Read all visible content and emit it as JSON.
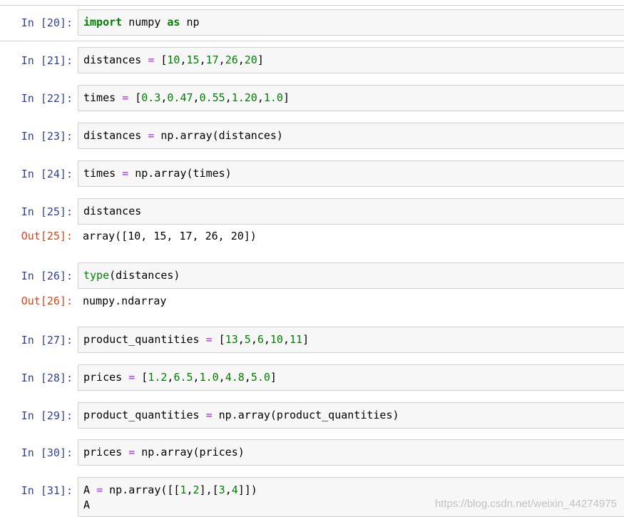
{
  "colors": {
    "prompt_in": "#303f9f",
    "prompt_out": "#d84315",
    "keyword": "#008000",
    "operator": "#aa22ff",
    "number": "#008000",
    "input_bg": "#f7f7f7",
    "input_border": "#cfcfcf"
  },
  "cells": [
    {
      "prompt": "In [20]:",
      "tokens": [
        {
          "t": "import",
          "c": "kw"
        },
        {
          "t": " numpy ",
          "c": ""
        },
        {
          "t": "as",
          "c": "kw"
        },
        {
          "t": " np",
          "c": ""
        }
      ]
    },
    {
      "prompt": "In [21]:",
      "tokens": [
        {
          "t": "distances ",
          "c": ""
        },
        {
          "t": "=",
          "c": "op"
        },
        {
          "t": " [",
          "c": ""
        },
        {
          "t": "10",
          "c": "num"
        },
        {
          "t": ",",
          "c": ""
        },
        {
          "t": "15",
          "c": "num"
        },
        {
          "t": ",",
          "c": ""
        },
        {
          "t": "17",
          "c": "num"
        },
        {
          "t": ",",
          "c": ""
        },
        {
          "t": "26",
          "c": "num"
        },
        {
          "t": ",",
          "c": ""
        },
        {
          "t": "20",
          "c": "num"
        },
        {
          "t": "]",
          "c": ""
        }
      ]
    },
    {
      "prompt": "In [22]:",
      "tokens": [
        {
          "t": "times ",
          "c": ""
        },
        {
          "t": "=",
          "c": "op"
        },
        {
          "t": " [",
          "c": ""
        },
        {
          "t": "0.3",
          "c": "num"
        },
        {
          "t": ",",
          "c": ""
        },
        {
          "t": "0.47",
          "c": "num"
        },
        {
          "t": ",",
          "c": ""
        },
        {
          "t": "0.55",
          "c": "num"
        },
        {
          "t": ",",
          "c": ""
        },
        {
          "t": "1.20",
          "c": "num"
        },
        {
          "t": ",",
          "c": ""
        },
        {
          "t": "1.0",
          "c": "num"
        },
        {
          "t": "]",
          "c": ""
        }
      ]
    },
    {
      "prompt": "In [23]:",
      "tokens": [
        {
          "t": "distances ",
          "c": ""
        },
        {
          "t": "=",
          "c": "op"
        },
        {
          "t": " np.array(distances)",
          "c": ""
        }
      ]
    },
    {
      "prompt": "In [24]:",
      "tokens": [
        {
          "t": "times ",
          "c": ""
        },
        {
          "t": "=",
          "c": "op"
        },
        {
          "t": " np.array(times)",
          "c": ""
        }
      ]
    },
    {
      "prompt": "In [25]:",
      "tokens": [
        {
          "t": "distances",
          "c": ""
        }
      ],
      "out_prompt": "Out[25]:",
      "output": "array([10, 15, 17, 26, 20])"
    },
    {
      "prompt": "In [26]:",
      "tokens": [
        {
          "t": "type",
          "c": "bi"
        },
        {
          "t": "(distances)",
          "c": ""
        }
      ],
      "out_prompt": "Out[26]:",
      "output": "numpy.ndarray"
    },
    {
      "prompt": "In [27]:",
      "tokens": [
        {
          "t": "product_quantities ",
          "c": ""
        },
        {
          "t": "=",
          "c": "op"
        },
        {
          "t": " [",
          "c": ""
        },
        {
          "t": "13",
          "c": "num"
        },
        {
          "t": ",",
          "c": ""
        },
        {
          "t": "5",
          "c": "num"
        },
        {
          "t": ",",
          "c": ""
        },
        {
          "t": "6",
          "c": "num"
        },
        {
          "t": ",",
          "c": ""
        },
        {
          "t": "10",
          "c": "num"
        },
        {
          "t": ",",
          "c": ""
        },
        {
          "t": "11",
          "c": "num"
        },
        {
          "t": "]",
          "c": ""
        }
      ]
    },
    {
      "prompt": "In [28]:",
      "tokens": [
        {
          "t": "prices ",
          "c": ""
        },
        {
          "t": "=",
          "c": "op"
        },
        {
          "t": " [",
          "c": ""
        },
        {
          "t": "1.2",
          "c": "num"
        },
        {
          "t": ",",
          "c": ""
        },
        {
          "t": "6.5",
          "c": "num"
        },
        {
          "t": ",",
          "c": ""
        },
        {
          "t": "1.0",
          "c": "num"
        },
        {
          "t": ",",
          "c": ""
        },
        {
          "t": "4.8",
          "c": "num"
        },
        {
          "t": ",",
          "c": ""
        },
        {
          "t": "5.0",
          "c": "num"
        },
        {
          "t": "]",
          "c": ""
        }
      ]
    },
    {
      "prompt": "In [29]:",
      "tokens": [
        {
          "t": "product_quantities ",
          "c": ""
        },
        {
          "t": "=",
          "c": "op"
        },
        {
          "t": " np.array(product_quantities)",
          "c": ""
        }
      ]
    },
    {
      "prompt": "In [30]:",
      "tokens": [
        {
          "t": "prices ",
          "c": ""
        },
        {
          "t": "=",
          "c": "op"
        },
        {
          "t": " np.array(prices)",
          "c": ""
        }
      ]
    },
    {
      "prompt": "In [31]:",
      "tokens": [
        {
          "t": "A ",
          "c": ""
        },
        {
          "t": "=",
          "c": "op"
        },
        {
          "t": " np.array([[",
          "c": ""
        },
        {
          "t": "1",
          "c": "num"
        },
        {
          "t": ",",
          "c": ""
        },
        {
          "t": "2",
          "c": "num"
        },
        {
          "t": "],[",
          "c": ""
        },
        {
          "t": "3",
          "c": "num"
        },
        {
          "t": ",",
          "c": ""
        },
        {
          "t": "4",
          "c": "num"
        },
        {
          "t": "]])",
          "c": ""
        }
      ],
      "line2": "A"
    }
  ],
  "watermark": "https://blog.csdn.net/weixin_44274975"
}
